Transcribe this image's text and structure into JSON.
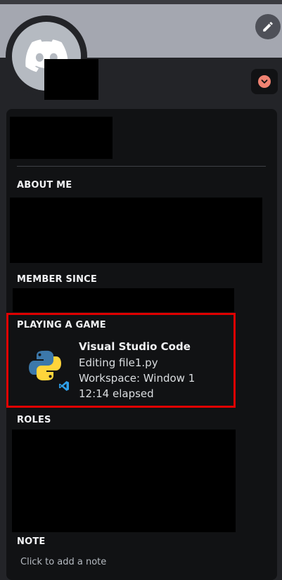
{
  "profile": {
    "edit_icon": "pencil-icon",
    "avatar_icon": "discord-logo-icon",
    "status_icon": "chevron-down-icon",
    "status_color": "#f08372"
  },
  "sections": {
    "about_me": "ABOUT ME",
    "member_since": "MEMBER SINCE",
    "playing": "PLAYING A GAME",
    "roles": "ROLES",
    "note": "NOTE"
  },
  "activity": {
    "name": "Visual Studio Code",
    "details": "Editing file1.py",
    "state": "Workspace: Window 1",
    "elapsed": "12:14 elapsed",
    "icon": "python-icon",
    "badge_icon": "vscode-icon",
    "highlight_color": "#e00000"
  },
  "note": {
    "placeholder": "Click to add a note"
  }
}
